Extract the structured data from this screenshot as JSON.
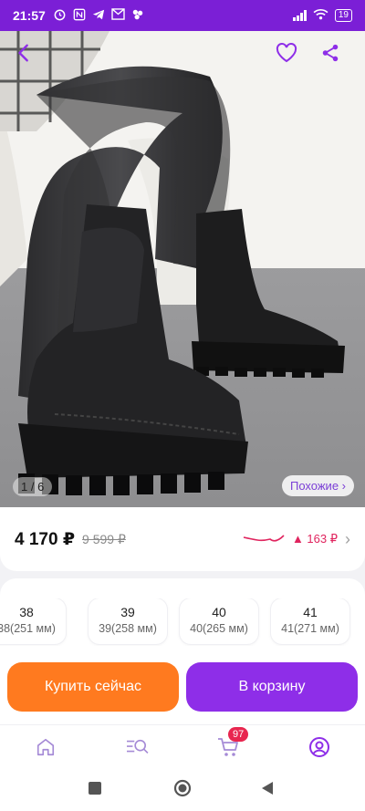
{
  "status_bar": {
    "time": "21:57",
    "battery": "19",
    "left_icons": [
      "alarm-icon",
      "nfc-icon",
      "telegram-icon",
      "mail-icon",
      "app-icon"
    ],
    "right_icons": [
      "signal-icon",
      "wifi-icon",
      "battery-icon"
    ]
  },
  "gallery": {
    "counter": "1 / 6",
    "similar_label": "Похожие ›",
    "icons": [
      "back-arrow-icon",
      "heart-icon",
      "share-icon"
    ]
  },
  "price": {
    "current": "4 170 ₽",
    "old": "9 599 ₽",
    "trend_delta": "▲ 163 ₽",
    "trend_color": "#e0245e"
  },
  "sizes": [
    {
      "size": "38",
      "mm": "38(251 мм)"
    },
    {
      "size": "39",
      "mm": "39(258 мм)"
    },
    {
      "size": "40",
      "mm": "40(265 мм)"
    },
    {
      "size": "41",
      "mm": "41(271 мм)"
    }
  ],
  "actions": {
    "buy_now": "Купить сейчас",
    "add_to_cart": "В корзину",
    "buy_color": "#ff7a1f",
    "cart_color": "#8e2ee8"
  },
  "bottom_nav": {
    "items": [
      "home-icon",
      "catalog-search-icon",
      "cart-icon",
      "profile-icon"
    ],
    "cart_badge": "97",
    "active": "profile-icon"
  },
  "system_nav": [
    "recents-icon",
    "home-circle-icon",
    "back-triangle-icon"
  ]
}
